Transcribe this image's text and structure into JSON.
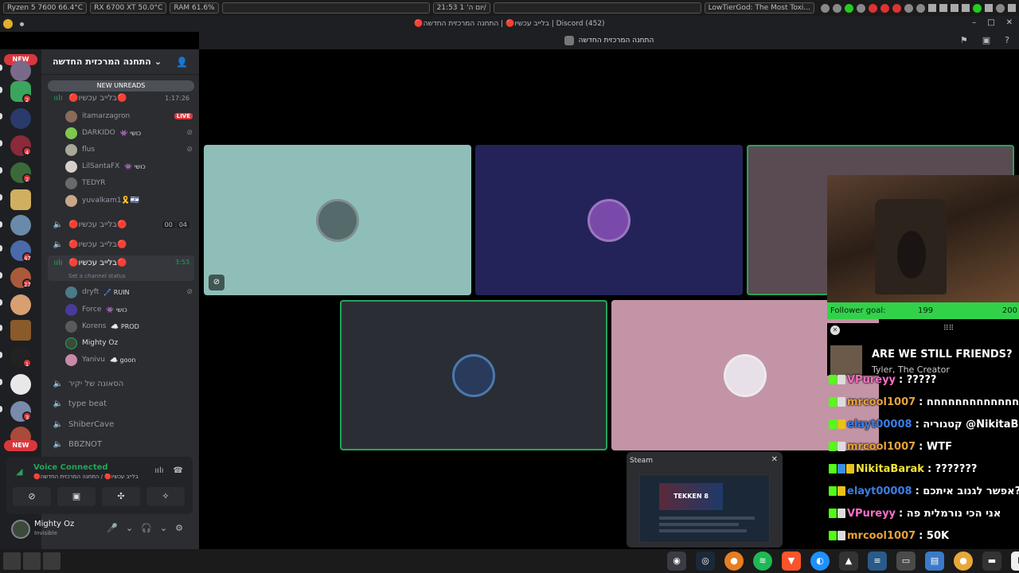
{
  "topbar": {
    "cpu": "Ryzen 5 7600  66.4°C",
    "gpu": "RX 6700 XT 50.0°C",
    "ram": "RAM   61.6%",
    "clock": "21:53 יום ה' 1/",
    "media": "LowTierGod: The Most Toxi..."
  },
  "window": {
    "title": "🔴בלייב עכשיו🔴 | התחנה המרכזית החדשה | Discord (452)"
  },
  "header": {
    "channel_title": "התחנה המרכזית החדשה"
  },
  "guild_bar": {
    "new_top": "NEW",
    "new_bottom": "NEW",
    "badges": [
      "2",
      "4",
      "2",
      "47",
      "27",
      "1",
      "3"
    ],
    "colors": {
      "red": "#da373c",
      "green": "#23a55a"
    }
  },
  "sidebar": {
    "server_name": "התחנה המרכזית החדשה",
    "new_unreads": "NEW UNREADS",
    "channels": [
      {
        "name": "🔴בלייב עכשיו🔴",
        "time": "1:17:26"
      },
      {
        "name": "🔴בלייב עכשיו🔴",
        "time_a": "00",
        "time_b": "04"
      },
      {
        "name": "🔴בלייב עכשיו🔴"
      },
      {
        "name": "🔴בלייב עכשיו🔴",
        "time": "3:53",
        "status": "Set a channel status"
      },
      {
        "name": "הסאונה של יקיר"
      },
      {
        "name": "type beat"
      },
      {
        "name": "ShiberCave"
      },
      {
        "name": "BBZNOT"
      }
    ],
    "users_a": [
      {
        "name": "itamarzagron",
        "live": "LIVE"
      },
      {
        "name": "DARKIDO",
        "tag": "👾 כושי"
      },
      {
        "name": "flus"
      },
      {
        "name": "LilSantaFX",
        "tag": "👾 כושי"
      },
      {
        "name": "TEDYR"
      },
      {
        "name": "yuvalkam1🎗️🇮🇱"
      }
    ],
    "users_b": [
      {
        "name": "dryft",
        "tag": "🖊️ RUIN"
      },
      {
        "name": "Force",
        "tag": "👾 כושי"
      },
      {
        "name": "Korens",
        "tag": "☁️ PROD"
      },
      {
        "name": "Mighty Oz"
      },
      {
        "name": "Yanivu",
        "tag": "☁️ goon"
      }
    ]
  },
  "voice": {
    "title": "Voice Connected",
    "subtitle": "🔴בלייב עכשיו🔴 / התחנה המרכזית החדשה"
  },
  "panel": {
    "username": "Mighty Oz",
    "status": "Invisible"
  },
  "tiles": [
    {
      "color": "#8fbeb9",
      "muted": true
    },
    {
      "color": "#23235a"
    },
    {
      "color": "#5a4b52",
      "speaking": true
    },
    {
      "color": "#2b2d35",
      "speaking": true
    },
    {
      "color": "#c294a6"
    }
  ],
  "steam": {
    "label": "Steam",
    "game": "TEKKEN 8"
  },
  "stream_overlay": {
    "follower_goal_label": "Follower goal:",
    "follower_value": "199",
    "follower_target": "200",
    "follower_progress": 0.995,
    "song": "ARE WE STILL FRIENDS?",
    "artist": "Tyler, The Creator",
    "chat": [
      {
        "nick": "VPureyy",
        "color": "#ff6ec7",
        "text": ": ?????"
      },
      {
        "nick": "mrcool1007",
        "color": "#e8a33a",
        "text": ": חחחחחחחחחחחחחחח"
      },
      {
        "nick": "elayt00008",
        "color": "#3a7ee6",
        "text": ": קטגוריה @NikitaBarak"
      },
      {
        "nick": "mrcool1007",
        "color": "#e8a33a",
        "text": ": WTF"
      },
      {
        "nick": "NikitaBarak",
        "color": "#f2e63a",
        "text": ": ???????"
      },
      {
        "nick": "elayt00008",
        "color": "#3a7ee6",
        "text": ": אפשר לגנוב איתכם?"
      },
      {
        "nick": "VPureyy",
        "color": "#ff6ec7",
        "text": ": אני הכי נורמלית פה"
      },
      {
        "nick": "mrcool1007",
        "color": "#e8a33a",
        "text": ": 50K"
      }
    ]
  }
}
